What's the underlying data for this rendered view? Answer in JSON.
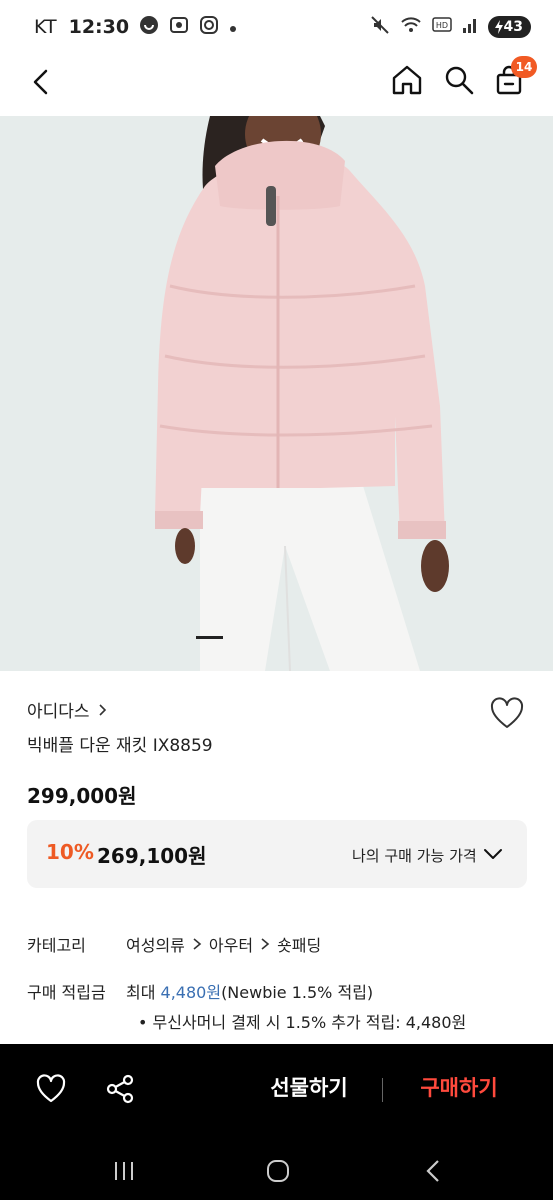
{
  "status_bar": {
    "carrier": "KT",
    "time": "12:30",
    "battery": "43"
  },
  "top_nav": {
    "cart_count": "14"
  },
  "product": {
    "brand": "아디다스",
    "name": "빅배플 다운 재킷 IX8859",
    "price": "299,000원"
  },
  "price_box": {
    "discount_rate": "10%",
    "discount_price": "269,100원",
    "label": "나의 구매 가능 가격"
  },
  "info": {
    "category_label": "카테고리",
    "categories": [
      "여성의류",
      "아우터",
      "숏패딩"
    ],
    "points_label": "구매 적립금",
    "points_prefix": "최대 ",
    "points_value": "4,480원",
    "points_suffix": "(Newbie 1.5% 적립)",
    "points_bullet": "• 무신사머니 결제 시 1.5% 추가 적립: 4,480원"
  },
  "bottom_bar": {
    "gift_label": "선물하기",
    "buy_label": "구매하기",
    "buy_color": "#ff4a3d"
  },
  "colors": {
    "accent_orange": "#ee5a24",
    "badge": "#f15a24",
    "link_blue": "#3a6fb2"
  }
}
